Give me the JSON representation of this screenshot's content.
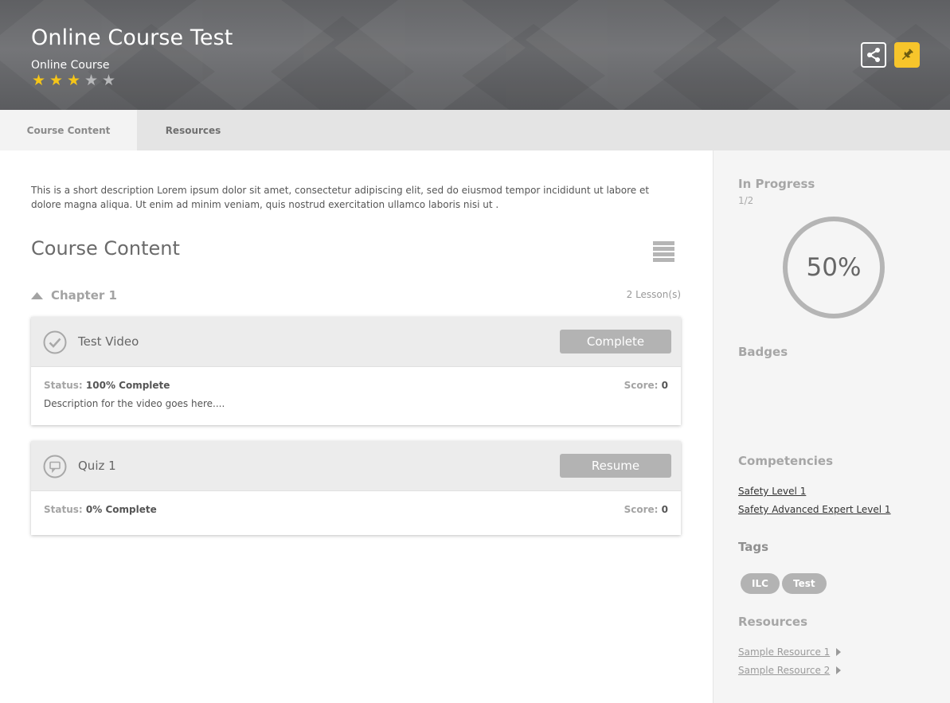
{
  "header": {
    "title": "Online Course Test",
    "subtitle": "Online Course",
    "rating": {
      "value": 3,
      "max": 5
    },
    "share_icon": "share-icon",
    "pin_icon": "pin-icon",
    "accent_color": "#f7c52b"
  },
  "tabs": [
    {
      "label": "Course Content",
      "active": true
    },
    {
      "label": "Resources",
      "active": false
    }
  ],
  "main": {
    "description": "This is a short description Lorem ipsum dolor sit amet, consectetur adipiscing elit, sed do eiusmod tempor incididunt ut labore et dolore magna aliqua. Ut enim ad minim veniam, quis nostrud exercitation ullamco laboris nisi ut .",
    "section_title": "Course Content",
    "chapter": {
      "title": "Chapter 1",
      "lesson_count": "2 Lesson(s)"
    },
    "lessons": [
      {
        "title": "Test Video",
        "icon": "check-circle-icon",
        "button": "Complete",
        "status_label": "Status:",
        "status_value": "100% Complete",
        "score_label": "Score:",
        "score_value": "0",
        "description": "Description for the video goes here...."
      },
      {
        "title": "Quiz 1",
        "icon": "quiz-icon",
        "button": "Resume",
        "status_label": "Status:",
        "status_value": "0% Complete",
        "score_label": "Score:",
        "score_value": "0"
      }
    ]
  },
  "sidebar": {
    "progress_heading": "In Progress",
    "progress_count": "1/2",
    "progress_percent": "50%",
    "progress_fraction": 0.5,
    "badges_heading": "Badges",
    "competencies_heading": "Competencies",
    "competencies": [
      "Safety Level 1",
      "Safety Advanced Expert Level 1"
    ],
    "tags_heading": "Tags",
    "tags": [
      "ILC",
      "Test"
    ],
    "resources_heading": "Resources",
    "resources": [
      "Sample Resource 1",
      "Sample Resource 2"
    ]
  }
}
